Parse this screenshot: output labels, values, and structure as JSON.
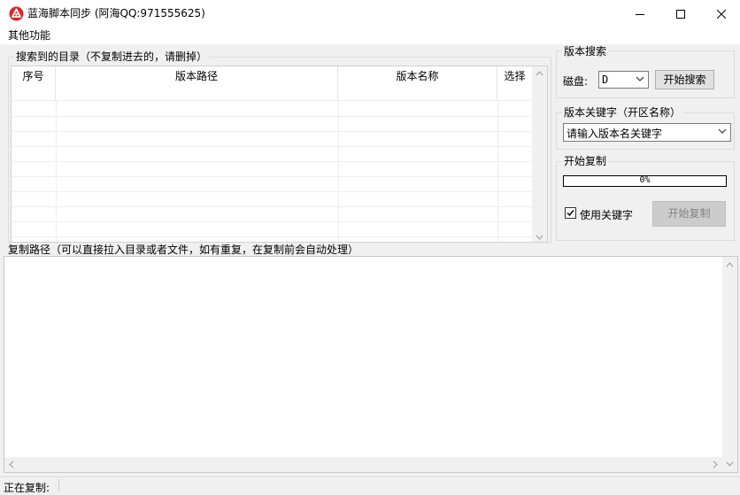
{
  "window": {
    "title": "蓝海脚本同步 (阿海QQ:971555625)"
  },
  "menu": {
    "items": [
      "其他功能"
    ]
  },
  "list_group": {
    "label": "搜索到的目录（不复制进去的，请删掉）",
    "columns": [
      "序号",
      "版本路径",
      "版本名称",
      "选择"
    ],
    "rows": []
  },
  "search_group": {
    "label": "版本搜索",
    "disk_label": "磁盘:",
    "disk_value": "D",
    "search_button": "开始搜索"
  },
  "keyword_group": {
    "label": "版本关键字（开区名称）",
    "placeholder": "请输入版本名关键字"
  },
  "copy_group": {
    "label": "开始复制",
    "progress_percent": 0,
    "progress_text": "0%",
    "use_keyword_label": "使用关键字",
    "use_keyword_checked": true,
    "copy_button": "开始复制"
  },
  "path_section": {
    "label": "复制路径（可以直接拉入目录或者文件，如有重复，在复制前会自动处理）",
    "value": ""
  },
  "status": {
    "label": "正在复制:",
    "value": ""
  },
  "colors": {
    "progress_fill": "#06b025",
    "disabled_text": "#838383"
  },
  "icons": {
    "app": "app-logo-icon",
    "minimize": "minimize-icon",
    "maximize": "maximize-icon",
    "close": "close-icon"
  }
}
